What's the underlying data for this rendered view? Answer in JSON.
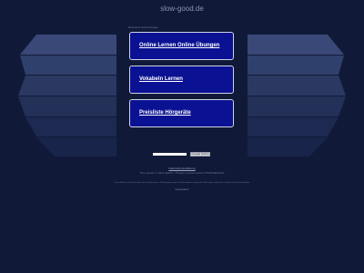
{
  "header": {
    "domain_title": "slow-good.de"
  },
  "related": {
    "label": "Relevante Suchanfragen",
    "links": [
      {
        "label": "Online Lernen Online Übungen"
      },
      {
        "label": "Vokabeln Lernen"
      },
      {
        "label": "Preisliste Hörgeräte"
      }
    ]
  },
  "search": {
    "input_value": "",
    "button_label": "Google Suche"
  },
  "footer": {
    "privacy_label": "Datenschutzerklärung",
    "copyright": "This domain © 2021 SEDO. / Privacy Contact and/or STORNIERUNG",
    "disclaimer": "Diese Website ist für Interessenten des Domainnamens. Die Anzeigen werden von Drittanbietern bereitgestellt. Bei Fragen wenden Sie sich bitte an den Domaininhaber.",
    "imprint_label": "Impressum"
  },
  "colors": {
    "background": "#101a38",
    "link_box": "#0a1192",
    "panel": "#2a3660"
  }
}
